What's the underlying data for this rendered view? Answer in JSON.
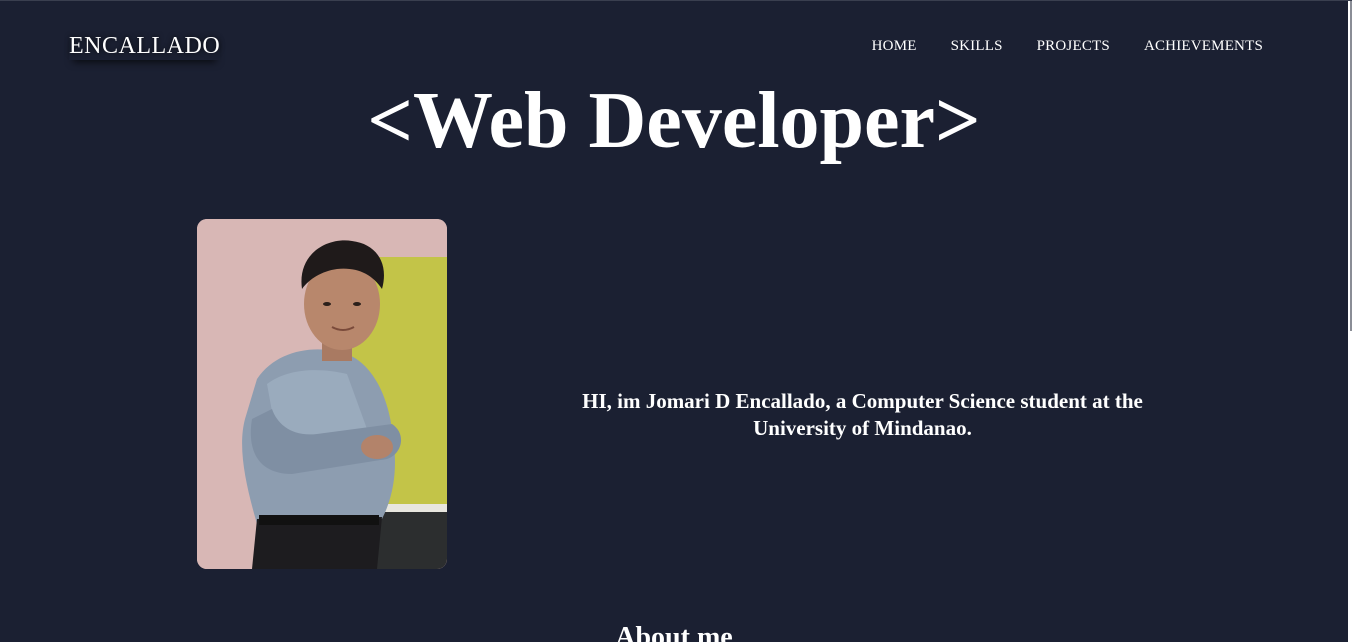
{
  "header": {
    "logo": "ENCALLADO",
    "nav": [
      {
        "label": "HOME"
      },
      {
        "label": "SKILLS"
      },
      {
        "label": "PROJECTS"
      },
      {
        "label": "ACHIEVEMENTS"
      }
    ]
  },
  "hero": {
    "title": "<Web Developer>",
    "intro": "HI, im Jomari D Encallado, a Computer Science student at the University of Mindanao."
  },
  "about": {
    "heading": "About me"
  },
  "colors": {
    "background": "#1b2032",
    "text": "#ffffff"
  }
}
